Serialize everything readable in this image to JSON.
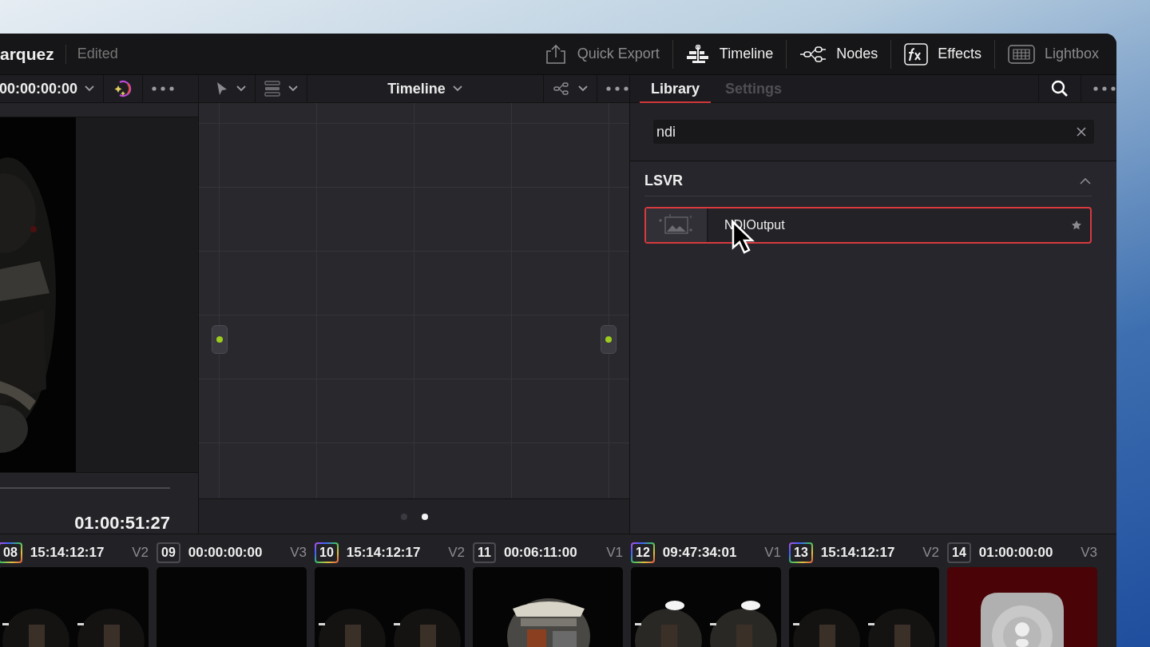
{
  "window": {
    "title": "arquez",
    "status": "Edited"
  },
  "page_buttons": [
    {
      "label": "Quick Export",
      "kind": "export",
      "dimmed": true
    },
    {
      "label": "Timeline",
      "kind": "timeline",
      "dimmed": false
    },
    {
      "label": "Nodes",
      "kind": "nodes",
      "dimmed": false
    },
    {
      "label": "Effects",
      "kind": "effects",
      "dimmed": false
    },
    {
      "label": "Lightbox",
      "kind": "lightbox",
      "dimmed": true
    }
  ],
  "viewer": {
    "timecode": "00:00:00:00",
    "playhead_timecode": "01:00:51:27"
  },
  "node_editor": {
    "view_menu": "Timeline",
    "pages": [
      {
        "selected": false
      },
      {
        "selected": true
      }
    ]
  },
  "effects": {
    "tabs": [
      {
        "label": "Library",
        "selected": true
      },
      {
        "label": "Settings",
        "selected": false
      }
    ],
    "search": {
      "value": "ndi"
    },
    "groups": [
      {
        "name": "LSVR",
        "expanded": true,
        "items": [
          {
            "name": "NDIOutput",
            "selected": true
          }
        ]
      }
    ]
  },
  "clips": [
    {
      "number": "08",
      "timecode": "15:14:12:17",
      "track": "V2",
      "color_flag": true,
      "kind": "dark"
    },
    {
      "number": "09",
      "timecode": "00:00:00:00",
      "track": "V3",
      "color_flag": false,
      "kind": "black"
    },
    {
      "number": "10",
      "timecode": "15:14:12:17",
      "track": "V2",
      "color_flag": true,
      "kind": "dark"
    },
    {
      "number": "11",
      "timecode": "00:06:11:00",
      "track": "V1",
      "color_flag": false,
      "kind": "bright"
    },
    {
      "number": "12",
      "timecode": "09:47:34:01",
      "track": "V1",
      "color_flag": true,
      "kind": "lights"
    },
    {
      "number": "13",
      "timecode": "15:14:12:17",
      "track": "V2",
      "color_flag": true,
      "kind": "dark"
    },
    {
      "number": "14",
      "timecode": "01:00:00:00",
      "track": "V3",
      "color_flag": false,
      "kind": "offline"
    }
  ]
}
